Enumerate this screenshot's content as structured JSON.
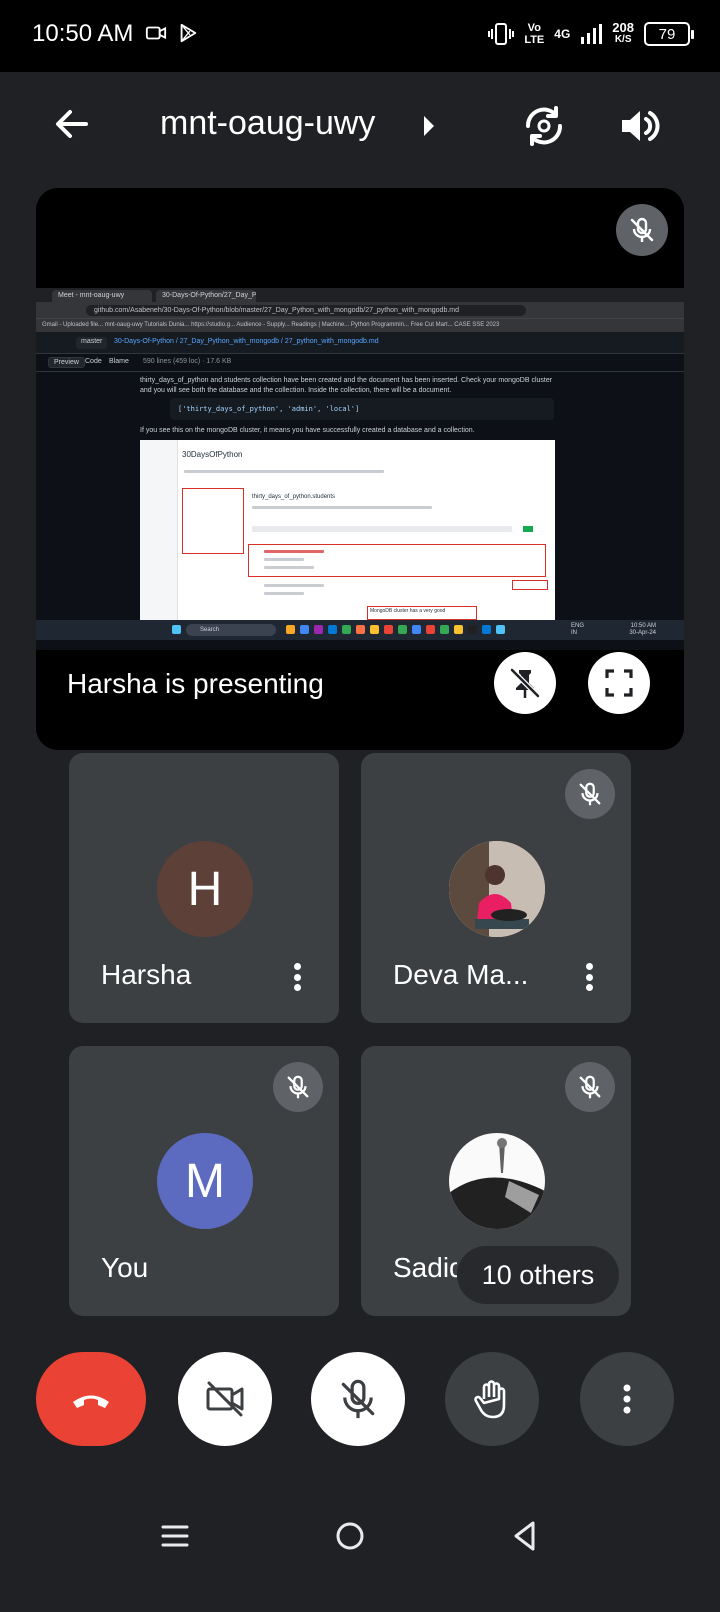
{
  "status_bar": {
    "time": "10:50 AM",
    "network_volte": "Vo\nLTE",
    "network_type": "4G",
    "data_speed_value": "208",
    "data_speed_unit": "K/S",
    "battery": "79",
    "icons": [
      "video-camera-icon",
      "play-store-icon",
      "vibrate-icon",
      "signal-icon"
    ]
  },
  "header": {
    "title": "mnt-oaug-uwy",
    "back_icon": "arrow-left-icon",
    "switch_camera_icon": "switch-camera-icon",
    "speaker_icon": "speaker-icon"
  },
  "presentation": {
    "label": "Harsha is presenting",
    "mic_state": "muted",
    "shared_screen": {
      "tabs": [
        "Meet - mnt-oaug-uwy",
        "30-Days-Of-Python/27_Day_P..."
      ],
      "url": "github.com/Asabeneh/30-Days-Of-Python/blob/master/27_Day_Python_with_mongodb/27_python_with_mongodb.md",
      "bookmarks": "Gmail - Uploaded file...   mnt-oaug-uwy   Tutorials Dunia...   https://studio.g...   Audience - Supply...   Readings | Machine...   Python Programmin...   Free Cut Mart...   CASE SSE 2023",
      "branch": "master",
      "breadcrumb": "30-Days-Of-Python / 27_Day_Python_with_mongodb / 27_python_with_mongodb.md",
      "view_tabs": [
        "Preview",
        "Code",
        "Blame"
      ],
      "file_info": "590 lines (459 loc) · 17.6 KB",
      "paragraph_1": "thirty_days_of_python and students collection have been created and the document has been inserted. Check your mongoDB cluster and you will see both the database and the collection. Inside the collection, there will be a document.",
      "code": "['thirty_days_of_python', 'admin', 'local']",
      "paragraph_2": "If you see this on the mongoDB cluster, it means you have successfully created a database and a collection.",
      "atlas_title": "30DaysOfPython",
      "atlas_collection": "thirty_days_of_python.students",
      "callout": "MongoDB cluster has a very good",
      "taskbar_search": "Search",
      "taskbar_lang": "ENG\nIN",
      "taskbar_time": "10:50 AM\n30-Apr-24"
    }
  },
  "participants": [
    {
      "name": "Harsha",
      "initial": "H",
      "avatar_color": "#5d4037",
      "muted": false,
      "has_menu": true
    },
    {
      "name": "Deva Ma...",
      "initial": "",
      "avatar_color": "#8d6e63",
      "muted": true,
      "has_menu": true
    },
    {
      "name": "You",
      "initial": "M",
      "avatar_color": "#5c6bc0",
      "muted": true,
      "has_menu": false
    },
    {
      "name": "Sadiq",
      "initial": "",
      "avatar_color": "#424242",
      "muted": true,
      "has_menu": false,
      "others_chip": "10 others"
    }
  ],
  "controls": {
    "end_call_color": "#ea4335",
    "buttons": [
      "end-call",
      "camera-off",
      "mic-off",
      "raise-hand",
      "more-options"
    ]
  },
  "colors": {
    "background": "#202124",
    "tile": "#3c4043",
    "muted_badge": "#5f6368"
  }
}
